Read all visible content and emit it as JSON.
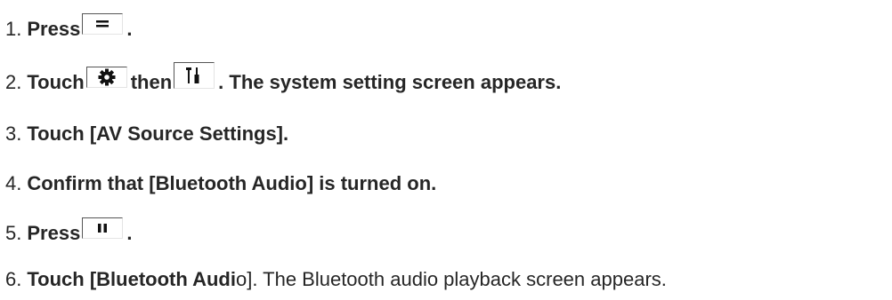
{
  "steps": [
    {
      "number": "1.",
      "parts": [
        "Press",
        "."
      ]
    },
    {
      "number": "2.",
      "parts": [
        "Touch",
        "then",
        ". The system setting screen appears."
      ]
    },
    {
      "number": "3.",
      "parts": [
        "Touch [AV Source Settings]."
      ]
    },
    {
      "number": "4.",
      "parts": [
        "Confirm that [Bluetooth Audio] is turned on."
      ]
    },
    {
      "number": "5.",
      "parts": [
        "Press",
        "."
      ]
    },
    {
      "number": "6.",
      "parts": [
        "Touch [Bluetooth Audi",
        "o]. The Bluetooth audio playback screen appears."
      ]
    }
  ],
  "icons": [
    "menu-button-icon",
    "gear-icon",
    "tools-icon",
    "pause-button-icon"
  ],
  "colors": {
    "text": "#262626",
    "icon": "#111111"
  }
}
